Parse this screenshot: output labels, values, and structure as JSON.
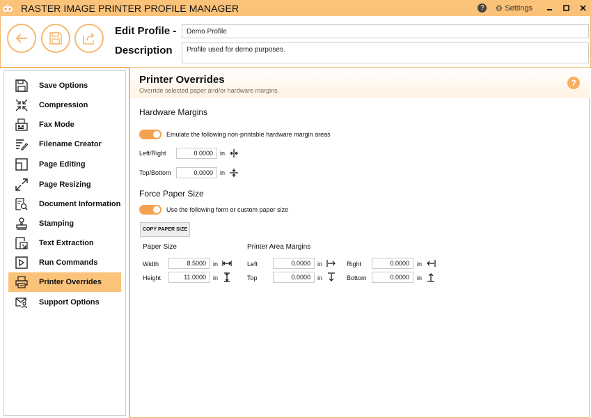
{
  "app": {
    "title": "RASTER IMAGE PRINTER PROFILE MANAGER",
    "settings_label": "Settings",
    "accent_color": "#fbc27a"
  },
  "header": {
    "edit_profile_label": "Edit Profile -",
    "description_label": "Description",
    "profile_name": "Demo Profile",
    "profile_description": "Profile used for demo purposes."
  },
  "sidebar": {
    "items": [
      {
        "label": "Save Options",
        "icon": "save-icon"
      },
      {
        "label": "Compression",
        "icon": "compress-icon"
      },
      {
        "label": "Fax Mode",
        "icon": "fax-icon"
      },
      {
        "label": "Filename Creator",
        "icon": "filename-icon"
      },
      {
        "label": "Page Editing",
        "icon": "page-edit-icon"
      },
      {
        "label": "Page Resizing",
        "icon": "resize-icon"
      },
      {
        "label": "Document Information",
        "icon": "doc-info-icon"
      },
      {
        "label": "Stamping",
        "icon": "stamp-icon"
      },
      {
        "label": "Text Extraction",
        "icon": "text-extract-icon"
      },
      {
        "label": "Run Commands",
        "icon": "run-icon"
      },
      {
        "label": "Printer Overrides",
        "icon": "printer-icon",
        "active": true
      },
      {
        "label": "Support Options",
        "icon": "support-icon"
      }
    ]
  },
  "page": {
    "title": "Printer Overrides",
    "subtitle": "Override selected paper and/or hardware margins."
  },
  "hardware": {
    "title": "Hardware Margins",
    "toggle_label": "Emulate the following non-printable hardware margin areas",
    "toggle_on": true,
    "left_right_label": "Left/Right",
    "left_right_value": "0.0000",
    "top_bottom_label": "Top/Bottom",
    "top_bottom_value": "0.0000",
    "unit": "in"
  },
  "paper": {
    "title": "Force Paper Size",
    "toggle_label": "Use the following form or custom paper size",
    "toggle_on": true,
    "copy_button": "COPY PAPER SIZE",
    "size_title": "Paper Size",
    "width_label": "Width",
    "width_value": "8.5000",
    "height_label": "Height",
    "height_value": "11.0000",
    "margins_title": "Printer Area Margins",
    "left_label": "Left",
    "left_value": "0.0000",
    "top_label": "Top",
    "top_value": "0.0000",
    "right_label": "Right",
    "right_value": "0.0000",
    "bottom_label": "Bottom",
    "bottom_value": "0.0000",
    "unit": "in"
  }
}
